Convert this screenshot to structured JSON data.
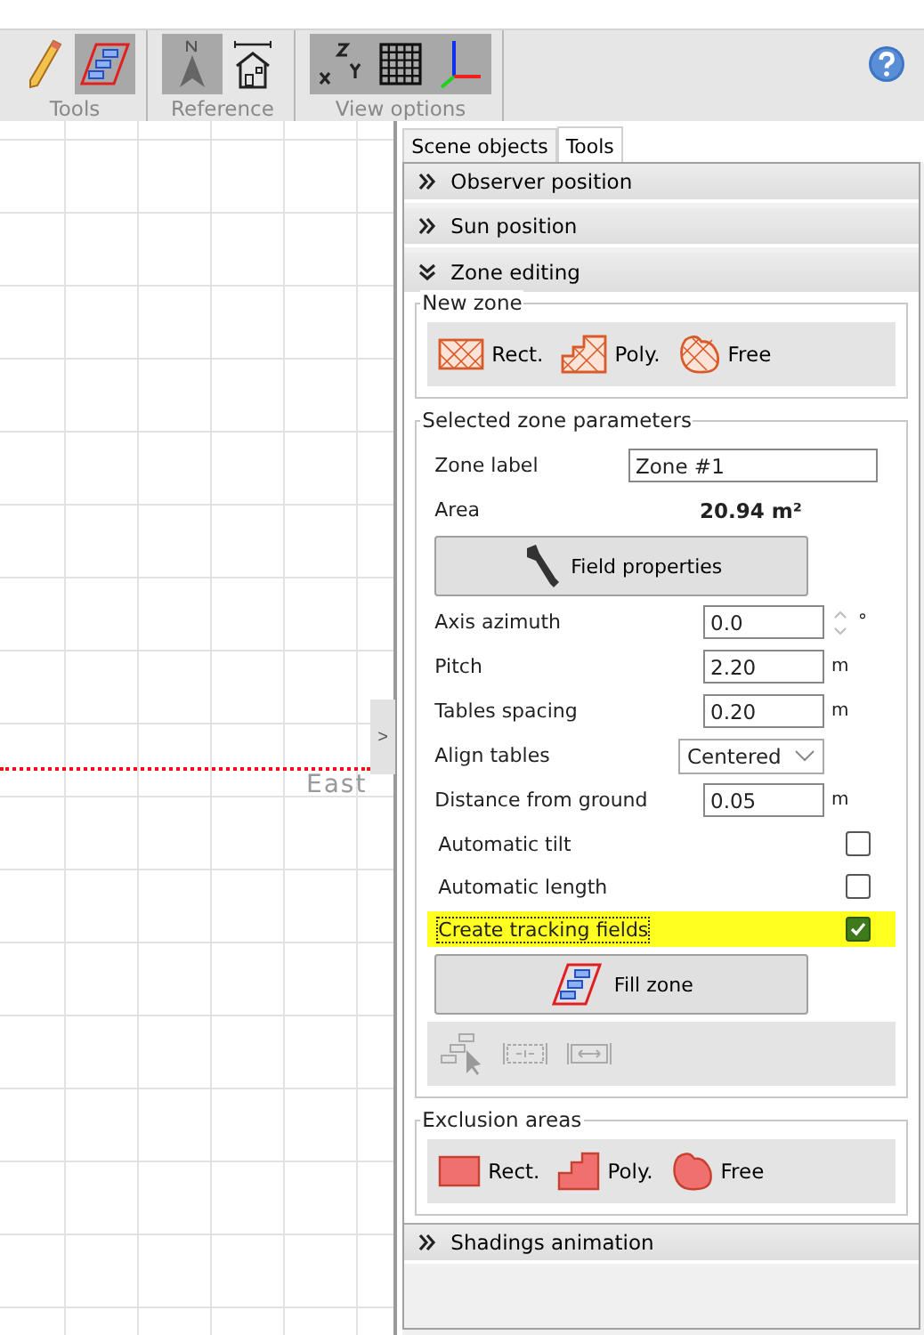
{
  "toolbar": {
    "groups": [
      {
        "label": "Tools",
        "buttons": [
          {
            "kind": "pencil",
            "selected": false
          },
          {
            "kind": "zone-fill",
            "selected": true
          }
        ]
      },
      {
        "label": "Reference",
        "buttons": [
          {
            "kind": "north",
            "selected": true
          },
          {
            "kind": "house",
            "selected": false
          }
        ]
      },
      {
        "label": "View options",
        "buttons": [
          {
            "kind": "xyz",
            "selected": true
          },
          {
            "kind": "grid",
            "selected": true
          },
          {
            "kind": "axes",
            "selected": true
          }
        ]
      }
    ]
  },
  "canvas": {
    "direction_label": "East",
    "panel_toggle": ">"
  },
  "tabs": [
    {
      "label": "Scene objects",
      "selected": false
    },
    {
      "label": "Tools",
      "selected": true
    }
  ],
  "sections": [
    {
      "title": "Observer position",
      "expanded": false
    },
    {
      "title": "Sun position",
      "expanded": false
    },
    {
      "title": "Zone editing",
      "expanded": true
    },
    {
      "title": "Shadings animation",
      "expanded": false
    }
  ],
  "zone_editing": {
    "new_zone": {
      "title": "New zone",
      "tools": [
        {
          "kind": "hatch-rect",
          "label": "Rect."
        },
        {
          "kind": "hatch-poly",
          "label": "Poly."
        },
        {
          "kind": "hatch-free",
          "label": "Free"
        }
      ]
    },
    "parameters": {
      "title": "Selected zone parameters",
      "zone_label": {
        "label": "Zone label",
        "value": "Zone #1"
      },
      "area": {
        "label": "Area",
        "value": "20.94 m²"
      },
      "field_properties": "Field properties",
      "fields": [
        {
          "kind": "spin",
          "label": "Axis azimuth",
          "value": "0.0",
          "unit": "°"
        },
        {
          "kind": "text",
          "label": "Pitch",
          "value": "2.20",
          "unit": "m"
        },
        {
          "kind": "text",
          "label": "Tables spacing",
          "value": "0.20",
          "unit": "m"
        },
        {
          "kind": "select",
          "label": "Align tables",
          "value": "Centered"
        },
        {
          "kind": "text",
          "label": "Distance from ground",
          "value": "0.05",
          "unit": "m"
        }
      ],
      "checkboxes": [
        {
          "label": "Automatic tilt",
          "checked": false,
          "highlighted": false
        },
        {
          "label": "Automatic length",
          "checked": false,
          "highlighted": false
        },
        {
          "label": "Create tracking fields",
          "checked": true,
          "highlighted": true
        }
      ],
      "fill_zone": "Fill zone",
      "tools": [
        {
          "kind": "select-tables",
          "disabled": true
        },
        {
          "kind": "shrink",
          "disabled": true
        },
        {
          "kind": "stretch",
          "disabled": true
        }
      ]
    },
    "exclusion": {
      "title": "Exclusion areas",
      "tools": [
        {
          "kind": "solid-rect",
          "label": "Rect."
        },
        {
          "kind": "solid-poly",
          "label": "Poly."
        },
        {
          "kind": "solid-free",
          "label": "Free"
        }
      ]
    }
  }
}
